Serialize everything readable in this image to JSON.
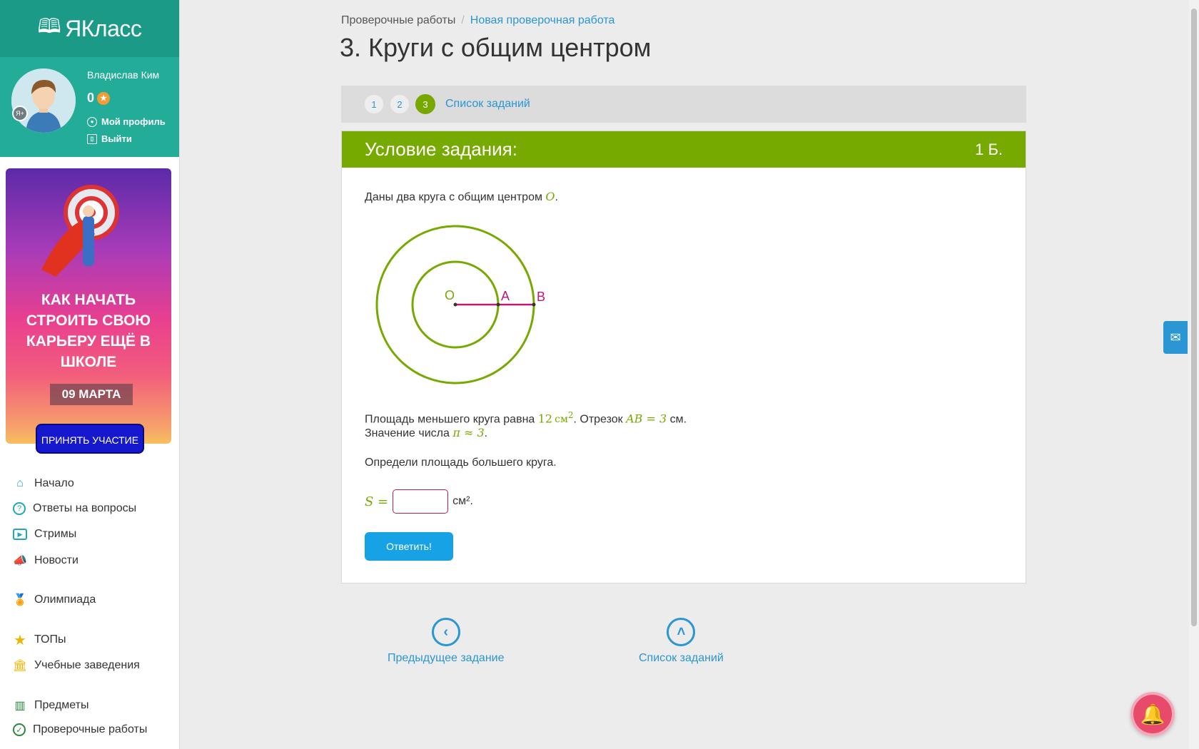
{
  "logo": {
    "text": "ЯКласс"
  },
  "profile": {
    "name": "Владислав Ким",
    "points": "0",
    "my_profile": "Мой профиль",
    "logout": "Выйти",
    "badge": "Я+"
  },
  "banner": {
    "title": "КАК НАЧАТЬ СТРОИТЬ СВОЮ КАРЬЕРУ ЕЩЁ В ШКОЛЕ",
    "date": "09 МАРТА",
    "button": "ПРИНЯТЬ УЧАСТИЕ"
  },
  "nav": {
    "items": [
      {
        "label": "Начало",
        "icon": "home-icon"
      },
      {
        "label": "Ответы на вопросы",
        "icon": "question-icon"
      },
      {
        "label": "Стримы",
        "icon": "play-icon"
      },
      {
        "label": "Новости",
        "icon": "megaphone-icon"
      },
      {
        "label": "Олимпиада",
        "icon": "medal-icon"
      },
      {
        "label": "ТОПы",
        "icon": "star-icon"
      },
      {
        "label": "Учебные заведения",
        "icon": "school-icon"
      },
      {
        "label": "Предметы",
        "icon": "books-icon"
      },
      {
        "label": "Проверочные работы",
        "icon": "check-circle-icon"
      }
    ]
  },
  "breadcrumb": {
    "root": "Проверочные работы",
    "current": "Новая проверочная работа"
  },
  "page_title": "3. Круги с общим центром",
  "stepper": {
    "steps": [
      "1",
      "2",
      "3"
    ],
    "active": "3",
    "list_link": "Список заданий"
  },
  "task": {
    "header": "Условие задания:",
    "points": "1 Б.",
    "line1_text": "Даны два круга с общим центром ",
    "line1_var": "O",
    "diagram_labels": {
      "O": "O",
      "A": "A",
      "B": "B"
    },
    "line2_a": "Площадь меньшего круга равна ",
    "line2_math1": "12",
    "line2_unit": "см",
    "line2_exp": "2",
    "line2_b": ". Отрезок ",
    "line2_math2": "AB = 3",
    "line2_c": " см.",
    "line3_a": "Значение числа ",
    "line3_math": "π ≈ 3",
    "line4": "Определи площадь большего круга.",
    "answer_label": "S =",
    "answer_value": "",
    "answer_unit": "см².",
    "submit": "Ответить!"
  },
  "bottom_nav": {
    "prev": "Предыдущее задание",
    "list": "Список заданий"
  },
  "colors": {
    "accent_green": "#76aa00",
    "teal": "#1a9a87",
    "link_blue": "#2a96d3",
    "pink": "#b0205a"
  }
}
